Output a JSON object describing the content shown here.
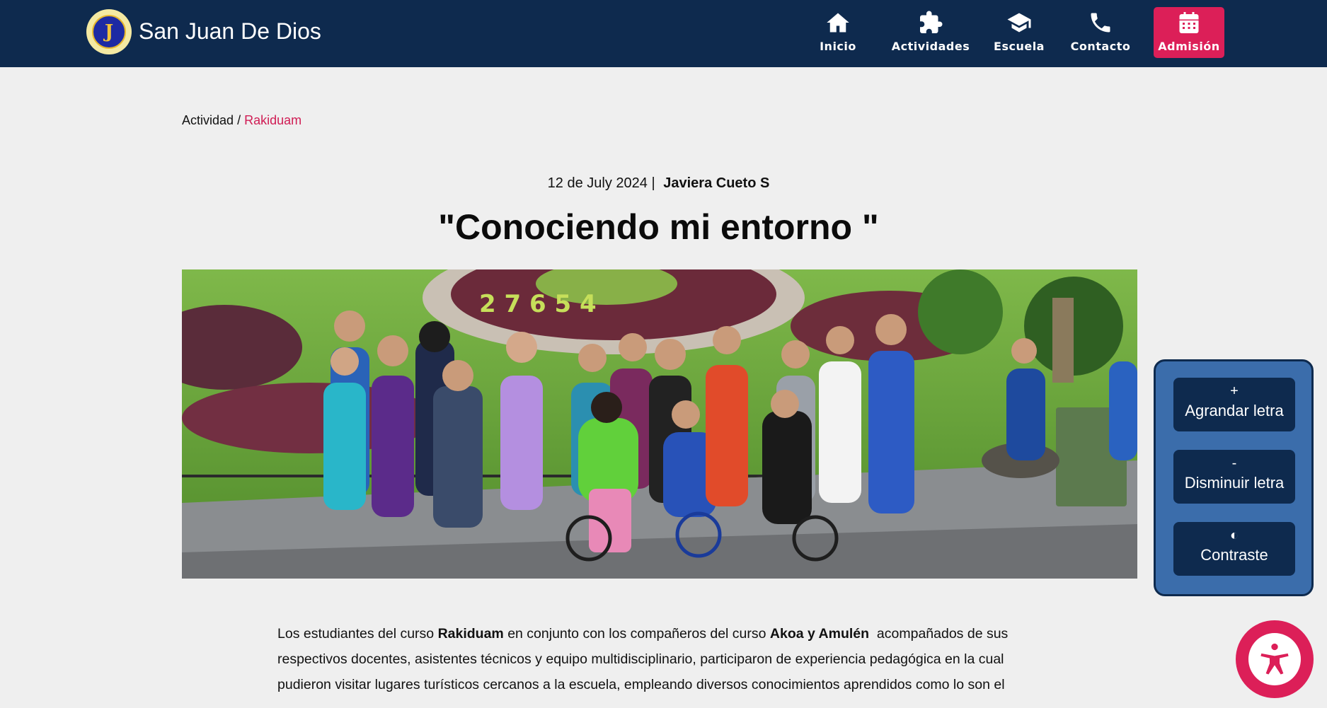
{
  "header": {
    "brand": "San Juan De Dios",
    "logo_icon": "school-crest-logo",
    "nav": [
      {
        "label": "Inicio",
        "icon": "home-icon"
      },
      {
        "label": "Actividades",
        "icon": "puzzle-icon"
      },
      {
        "label": "Escuela",
        "icon": "graduation-cap-icon"
      },
      {
        "label": "Contacto",
        "icon": "phone-icon"
      },
      {
        "label": "Admisión",
        "icon": "calendar-icon"
      }
    ],
    "accent": "#dc1f58",
    "bg": "#0e2a4e"
  },
  "breadcrumb": {
    "parent": "Actividad",
    "separator": "/",
    "current": "Rakiduam"
  },
  "post": {
    "date": "12 de July 2024",
    "separator": "|",
    "author": "Javiera Cueto S",
    "title": "\"Conociendo mi entorno \"",
    "image_alt": "group-photo"
  },
  "article": {
    "p1": "Los estudiantes del curso",
    "b1": "Rakiduam",
    "p2": "en conjunto con los compañeros del curso",
    "b2": "Akoa y Amulén",
    "p3": "acompañados de sus respectivos docentes, asistentes técnicos y equipo multidisciplinario, participaron de experiencia pedagógica en la cual pudieron visitar lugares turísticos cercanos a la escuela, empleando diversos conocimientos aprendidos como lo son el"
  },
  "accessibility": {
    "increase": {
      "symbol": "+",
      "label": "Agrandar letra"
    },
    "decrease": {
      "symbol": "-",
      "label": "Disminuir letra"
    },
    "contrast": {
      "symbol": "◐",
      "label": "Contraste"
    },
    "fab_icon": "accessibility-icon"
  }
}
